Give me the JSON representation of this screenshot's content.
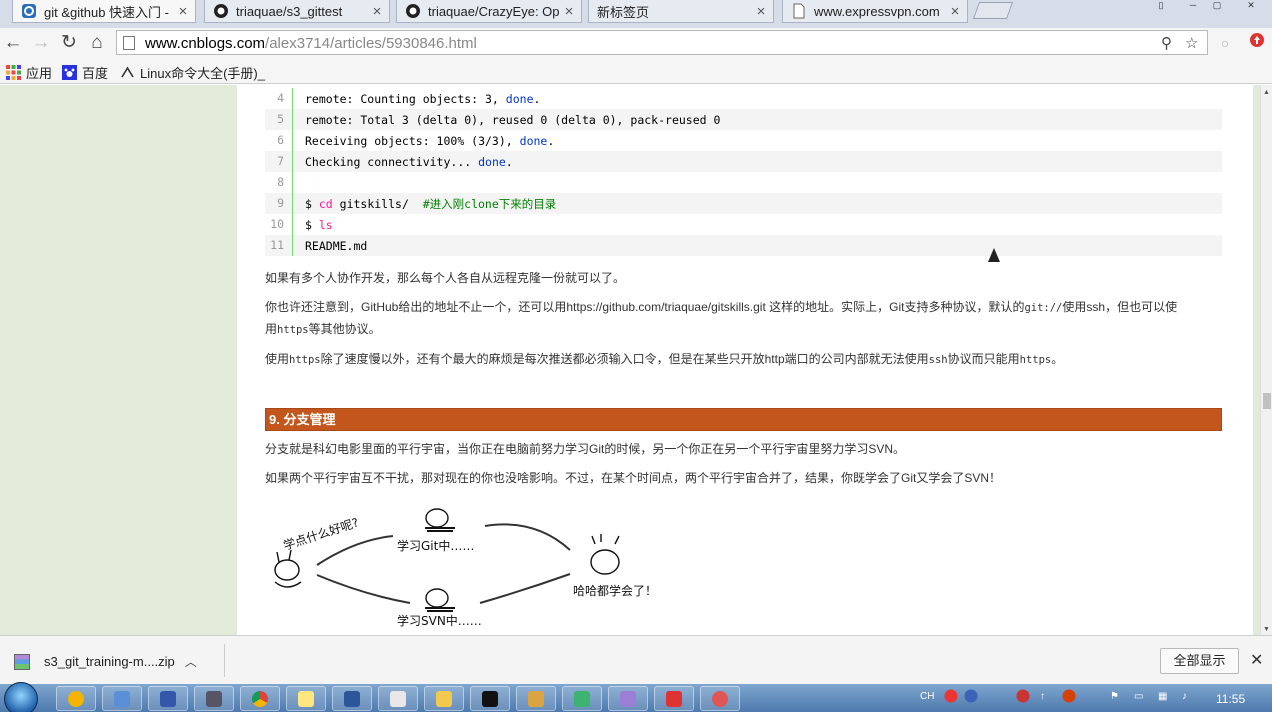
{
  "browser": {
    "tabs": [
      {
        "title": "git &github 快速入门 -",
        "icon": "cnblogs-icon",
        "active": true
      },
      {
        "title": "triaquae/s3_gittest",
        "icon": "github-icon",
        "active": false
      },
      {
        "title": "triaquae/CrazyEye: Ope",
        "icon": "github-icon",
        "active": false
      },
      {
        "title": "新标签页",
        "icon": "",
        "active": false
      },
      {
        "title": "www.expressvpn.com",
        "icon": "page-icon",
        "active": false
      }
    ],
    "url_domain": "www.cnblogs.com",
    "url_path": "/alex3714/articles/5930846.html",
    "bookmarks": [
      {
        "label": "应用",
        "icon": "apps-grid-icon"
      },
      {
        "label": "百度",
        "icon": "baidu-paw-icon"
      },
      {
        "label": "Linux命令大全(手册)_",
        "icon": "linux-command-icon"
      }
    ]
  },
  "article": {
    "code_lines": [
      {
        "n": "4",
        "parts": [
          {
            "t": "remote: Counting objects: 3, ",
            "c": ""
          },
          {
            "t": "done",
            "c": "kw"
          },
          {
            "t": ".",
            "c": ""
          }
        ]
      },
      {
        "n": "5",
        "parts": [
          {
            "t": "remote: Total 3 (delta 0), reused 0 (delta 0), pack-reused 0",
            "c": ""
          }
        ]
      },
      {
        "n": "6",
        "parts": [
          {
            "t": "Receiving objects: 100% (3/3), ",
            "c": ""
          },
          {
            "t": "done",
            "c": "kw"
          },
          {
            "t": ".",
            "c": ""
          }
        ]
      },
      {
        "n": "7",
        "parts": [
          {
            "t": "Checking connectivity... ",
            "c": ""
          },
          {
            "t": "done",
            "c": "kw"
          },
          {
            "t": ".",
            "c": ""
          }
        ]
      },
      {
        "n": "8",
        "parts": []
      },
      {
        "n": "9",
        "parts": [
          {
            "t": "$ ",
            "c": ""
          },
          {
            "t": "cd",
            "c": "cmd"
          },
          {
            "t": " gitskills/  ",
            "c": ""
          },
          {
            "t": "#进入刚clone下来的目录",
            "c": "cm"
          }
        ]
      },
      {
        "n": "10",
        "parts": [
          {
            "t": "$ ",
            "c": ""
          },
          {
            "t": "ls",
            "c": "cmd"
          }
        ]
      },
      {
        "n": "11",
        "parts": [
          {
            "t": "README.md",
            "c": ""
          }
        ]
      }
    ],
    "p1": "如果有多个人协作开发，那么每个人各自从远程克隆一份就可以了。",
    "p2a": "你也许还注意到，GitHub给出的地址不止一个，还可以用https://github.com/triaquae/gitskills.git 这样的地址。实际上，Git支持多种协议，默认的",
    "p2_code1": "git://",
    "p2b": "使用ssh，但也可以使",
    "p2c": "用",
    "p2_code2": "https",
    "p2d": "等其他协议。",
    "p3a": "使用",
    "p3_code1": "https",
    "p3b": "除了速度慢以外，还有个最大的麻烦是每次推送都必须输入口令，但是在某些只开放http端口的公司内部就无法使用",
    "p3_code2": "ssh",
    "p3c": "协议而只能用",
    "p3_code3": "https",
    "p3d": "。",
    "section_title": "9. 分支管理",
    "p4": "分支就是科幻电影里面的平行宇宙，当你正在电脑前努力学习Git的时候，另一个你正在另一个平行宇宙里努力学习SVN。",
    "p5": "如果两个平行宇宙互不干扰，那对现在的你也没啥影响。不过，在某个时间点，两个平行宇宙合并了，结果，你既学会了Git又学会了SVN！",
    "illus_labels": {
      "question": "学点什么好呢?",
      "git": "学习Git中……",
      "svn": "学习SVN中……",
      "done": "哈哈都学会了！"
    }
  },
  "downloads": {
    "file": "s3_git_training-m....zip",
    "show_all": "全部显示"
  },
  "taskbar": {
    "lang": "CH",
    "clock": "11:55"
  }
}
